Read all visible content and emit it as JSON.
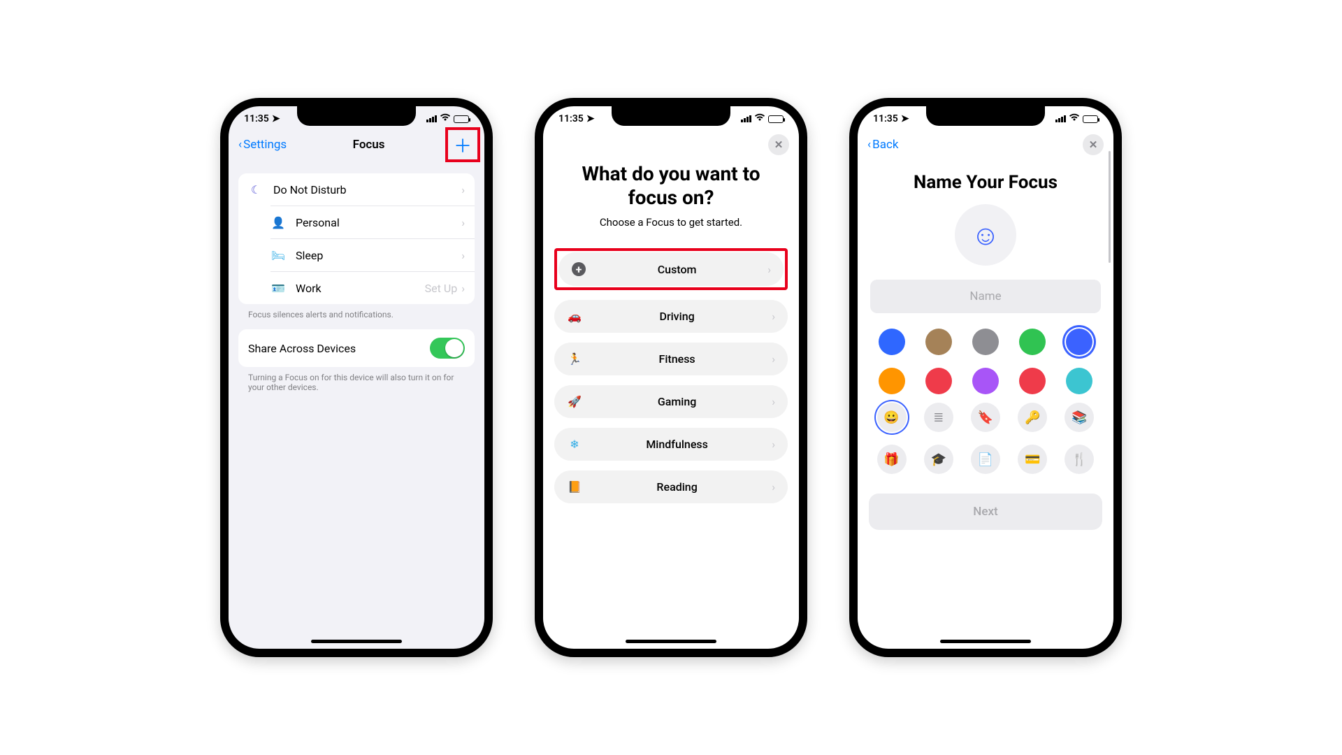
{
  "status": {
    "time": "11:35"
  },
  "screen1": {
    "back_label": "Settings",
    "title": "Focus",
    "items": [
      {
        "label": "Do Not Disturb",
        "icon": "moon",
        "color": "#5856d6"
      },
      {
        "label": "Personal",
        "icon": "person",
        "color": "#af52de"
      },
      {
        "label": "Sleep",
        "icon": "bed",
        "color": "#32ade6"
      },
      {
        "label": "Work",
        "icon": "badge",
        "color": "#32ade6",
        "right": "Set Up"
      }
    ],
    "caption": "Focus silences alerts and notifications.",
    "share_label": "Share Across Devices",
    "share_caption": "Turning a Focus on for this device will also turn it on for your other devices."
  },
  "screen2": {
    "title": "What do you want to focus on?",
    "subtitle": "Choose a Focus to get started.",
    "options": [
      {
        "label": "Custom",
        "glyph": "+",
        "color": "#5a5a5e",
        "highlight": true
      },
      {
        "label": "Driving",
        "glyph": "🚗",
        "color": "#2b6adf"
      },
      {
        "label": "Fitness",
        "glyph": "🏃",
        "color": "#30b14a"
      },
      {
        "label": "Gaming",
        "glyph": "🚀",
        "color": "#2b6adf"
      },
      {
        "label": "Mindfulness",
        "glyph": "❄",
        "color": "#32ade6"
      },
      {
        "label": "Reading",
        "glyph": "📙",
        "color": "#ff9500"
      }
    ]
  },
  "screen3": {
    "back_label": "Back",
    "title": "Name Your Focus",
    "placeholder": "Name",
    "colors": [
      "#2f67ff",
      "#a58258",
      "#8e8e93",
      "#30c352",
      "#3b62ff",
      "#ff9500",
      "#ef3b4a",
      "#a855f7",
      "#ef3b4a",
      "#3cc5d1"
    ],
    "selected_color_index": 4,
    "icons": [
      "😀",
      "≣",
      "🔖",
      "🔑",
      "📚",
      "🎁",
      "🎓",
      "📄",
      "💳",
      "🍴"
    ],
    "selected_icon_index": 0,
    "next_label": "Next"
  }
}
